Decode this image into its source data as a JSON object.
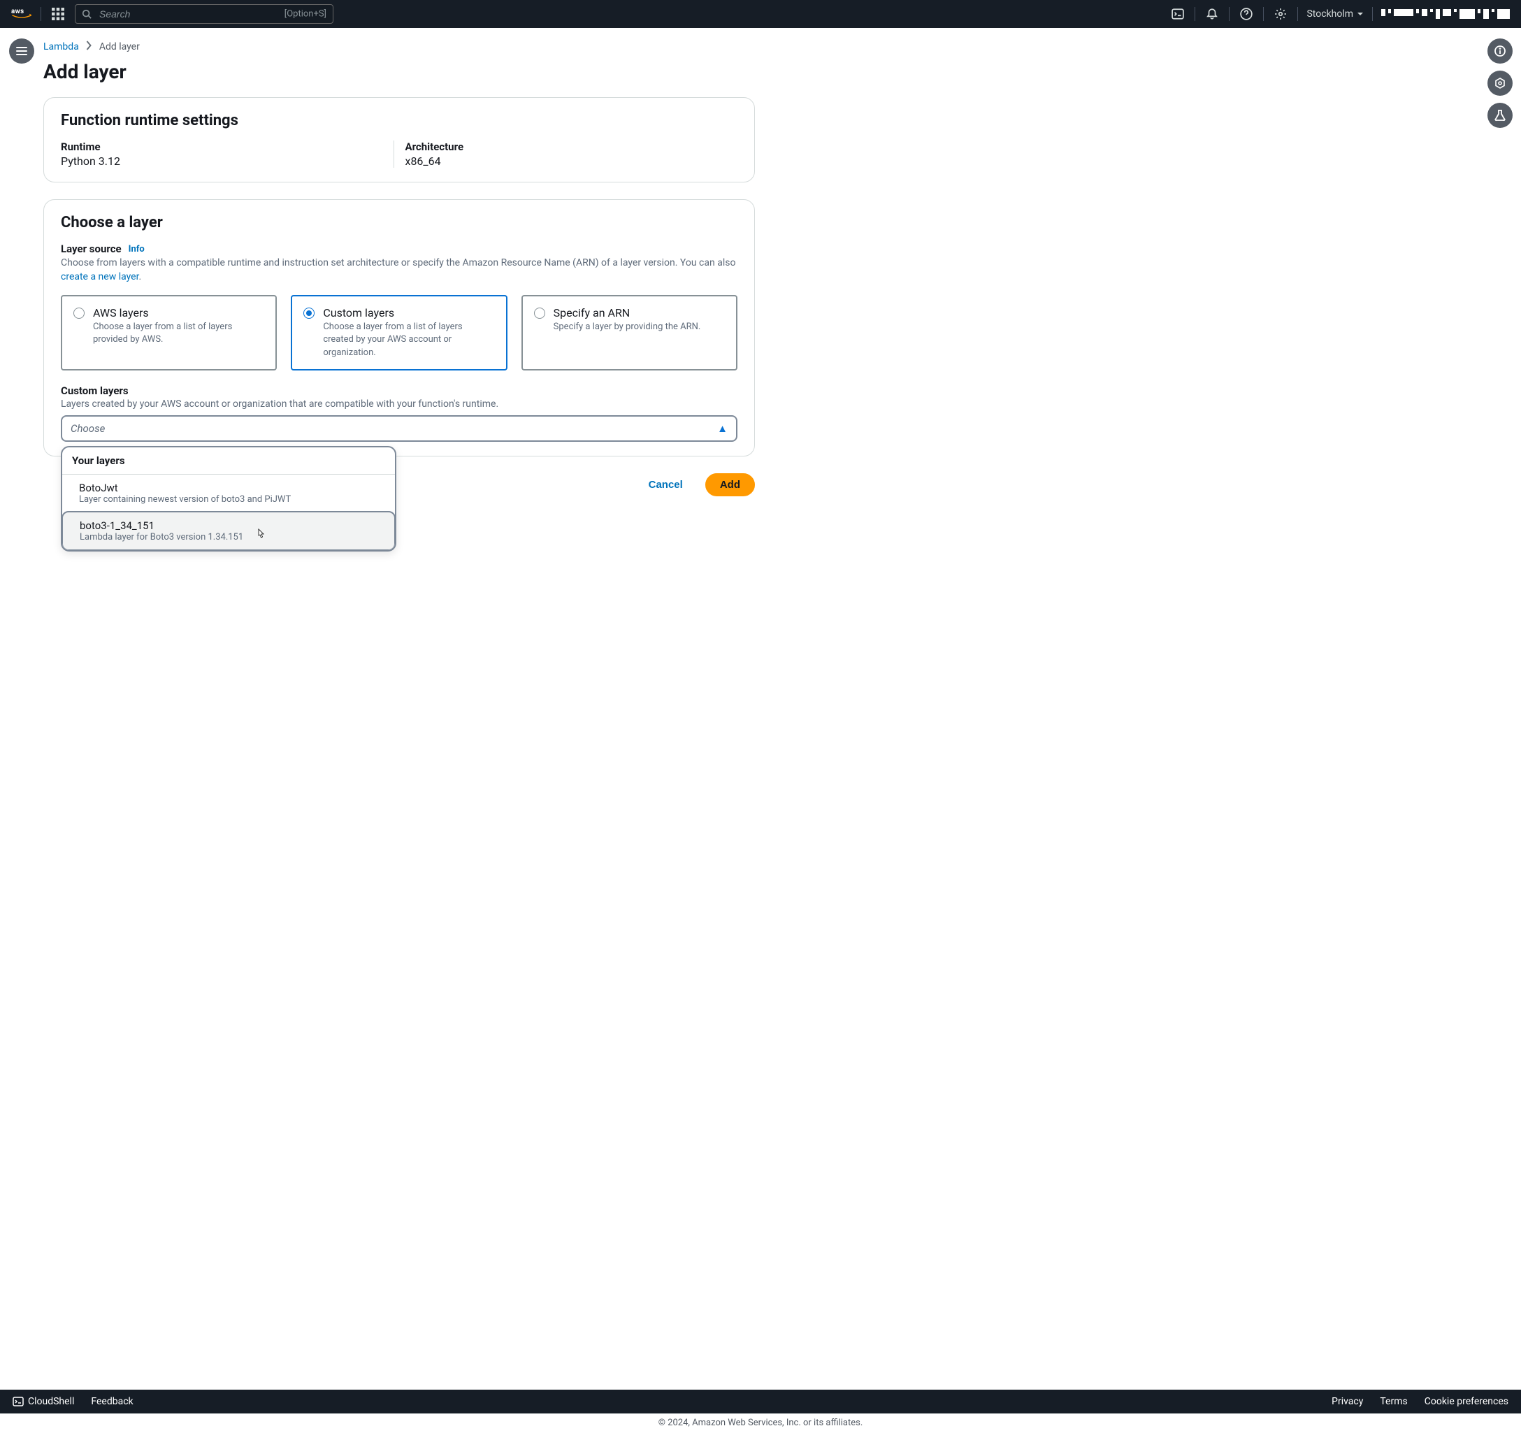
{
  "nav": {
    "logo": "aws",
    "searchPlaceholder": "Search",
    "searchShortcut": "[Option+S]",
    "region": "Stockholm"
  },
  "breadcrumb": {
    "lambda": "Lambda",
    "current": "Add layer"
  },
  "pageTitle": "Add layer",
  "runtimePanel": {
    "heading": "Function runtime settings",
    "runtimeLabel": "Runtime",
    "runtimeValue": "Python 3.12",
    "archLabel": "Architecture",
    "archValue": "x86_64"
  },
  "layerPanel": {
    "heading": "Choose a layer",
    "sourceLabel": "Layer source",
    "infoLabel": "Info",
    "sourceDescPre": "Choose from layers with a compatible runtime and instruction set architecture or specify the Amazon Resource Name (ARN) of a layer version. You can also ",
    "sourceDescLink": "create a new layer",
    "sourceDescPost": ".",
    "radios": [
      {
        "title": "AWS layers",
        "desc": "Choose a layer from a list of layers provided by AWS."
      },
      {
        "title": "Custom layers",
        "desc": "Choose a layer from a list of layers created by your AWS account or organization."
      },
      {
        "title": "Specify an ARN",
        "desc": "Specify a layer by providing the ARN."
      }
    ],
    "customLabel": "Custom layers",
    "customDesc": "Layers created by your AWS account or organization that are compatible with your function's runtime.",
    "selectPlaceholder": "Choose",
    "dropdownHeader": "Your layers",
    "options": [
      {
        "title": "BotoJwt",
        "desc": "Layer containing newest version of boto3 and PiJWT"
      },
      {
        "title": "boto3-1_34_151",
        "desc": "Lambda layer for Boto3 version 1.34.151"
      }
    ]
  },
  "actions": {
    "cancel": "Cancel",
    "add": "Add"
  },
  "footer": {
    "cloudshell": "CloudShell",
    "feedback": "Feedback",
    "privacy": "Privacy",
    "terms": "Terms",
    "cookies": "Cookie preferences",
    "copyright": "© 2024, Amazon Web Services, Inc. or its affiliates."
  }
}
